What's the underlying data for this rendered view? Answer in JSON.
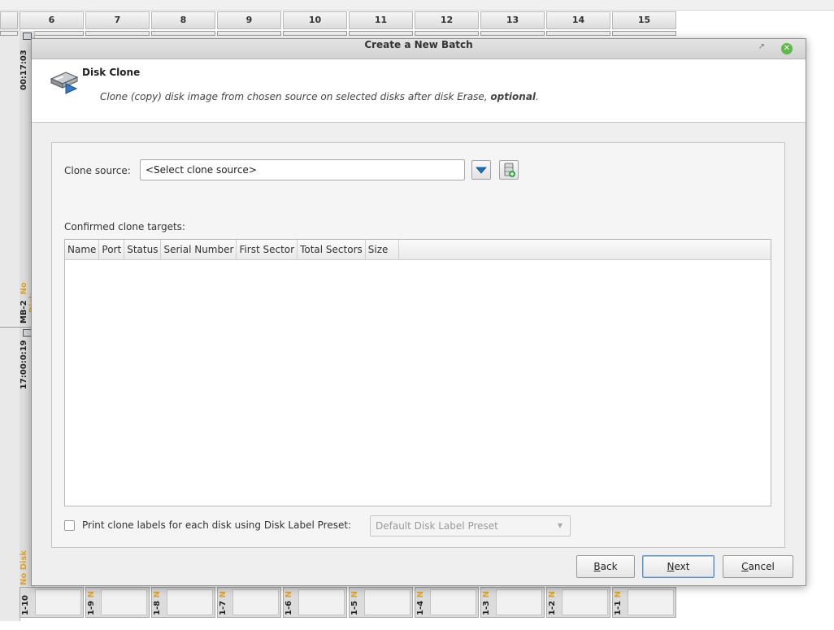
{
  "background_app": {
    "columns": [
      "6",
      "7",
      "8",
      "9",
      "10",
      "11",
      "12",
      "13",
      "14",
      "15"
    ],
    "left_strip": {
      "upper_timer": "00:17:03",
      "upper_slot": "MB-2",
      "upper_status": "No Disk",
      "lower_timer": "17:00:0:19",
      "lower_status": "No Disk"
    },
    "bottom_slots": [
      {
        "label": "1-10",
        "status": ""
      },
      {
        "label": "1-9",
        "status": "N"
      },
      {
        "label": "1-8",
        "status": "N"
      },
      {
        "label": "1-7",
        "status": "N"
      },
      {
        "label": "1-6",
        "status": "N"
      },
      {
        "label": "1-5",
        "status": "N"
      },
      {
        "label": "1-4",
        "status": "N"
      },
      {
        "label": "1-3",
        "status": "N"
      },
      {
        "label": "1-2",
        "status": "N"
      },
      {
        "label": "1-1",
        "status": "N"
      }
    ]
  },
  "dialog": {
    "title": "Create a New Batch",
    "header_title": "Disk Clone",
    "subtitle_main": "Clone (copy) disk image from chosen source on selected disks after disk Erase, ",
    "subtitle_bold": "optional",
    "subtitle_end": ".",
    "clone_source_label": "Clone source:",
    "clone_source_value": "<Select clone source>",
    "targets_label": "Confirmed clone targets:",
    "table_columns": [
      "Name",
      "Port",
      "Status",
      "Serial Number",
      "First Sector",
      "Total Sectors",
      "Size"
    ],
    "print_label": "Print clone labels for each disk using Disk Label Preset:",
    "preset_value": "Default Disk Label Preset",
    "buttons": {
      "back_mnemonic": "B",
      "back_rest": "ack",
      "next_mnemonic": "N",
      "next_rest": "ext",
      "cancel_mnemonic": "C",
      "cancel_rest": "ancel"
    },
    "colors": {
      "close_button": "#5fb84a",
      "dropdown_arrow": "#1f6fbf",
      "accent_orange": "#e2a42a"
    }
  }
}
